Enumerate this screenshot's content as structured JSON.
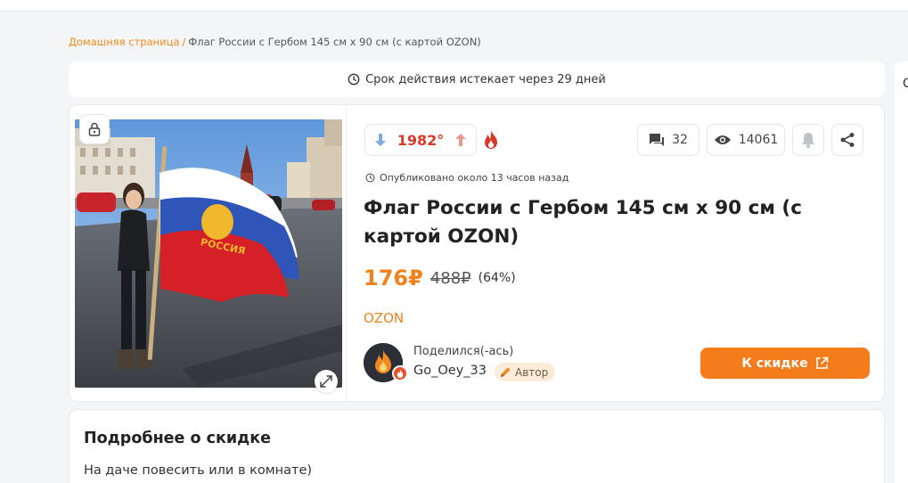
{
  "breadcrumb": {
    "home": "Домашняя страница",
    "separator": "/",
    "current": "Флаг России с Гербом 145 см х 90 см (с картой OZON)"
  },
  "expiry": {
    "text": "Срок действия истекает через 29 дней",
    "icon": "clock-icon"
  },
  "right_panel": {
    "partial_letter": "С"
  },
  "deal": {
    "temperature": "1982°",
    "comments_count": "32",
    "views_count": "14061",
    "published": "Опубликовано около 13 часов назад",
    "title": "Флаг России с Гербом 145 см х 90 см (с картой OZON)",
    "price": "176₽",
    "old_price": "488₽",
    "discount": "(64%)",
    "shop": "OZON",
    "shared_label": "Поделился(-ась)",
    "username": "Go_Oey_33",
    "author_badge": "Автор",
    "cta_label": "К скидке",
    "image_flag_text": "РОССИЯ"
  },
  "details": {
    "heading": "Подробнее о скидке",
    "text": "На даче повесить или в комнате)"
  },
  "colors": {
    "accent": "#f0821e",
    "hot": "#d9382b",
    "vote_down": "#7fa8e0",
    "vote_up": "#e89a8f",
    "cta": "#f47c1b"
  }
}
